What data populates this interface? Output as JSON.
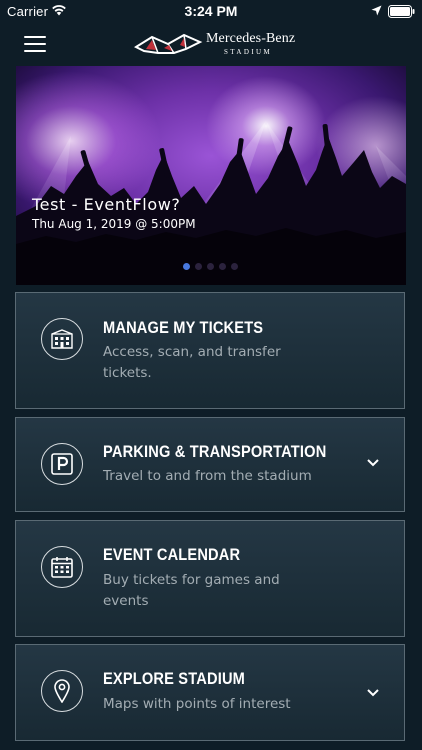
{
  "status_bar": {
    "carrier": "Carrier",
    "time": "3:24 PM"
  },
  "header": {
    "logo_name": "Mercedes-Benz",
    "logo_sub": "STADIUM"
  },
  "hero": {
    "title": "Test - EventFlow?",
    "subtitle": "Thu Aug 1, 2019 @ 5:00PM",
    "page_count": 5,
    "active_page": 1
  },
  "cards": [
    {
      "id": "manage-tickets",
      "icon": "stadium-icon",
      "title": "MANAGE MY TICKETS",
      "description": "Access, scan, and transfer tickets.",
      "expandable": false
    },
    {
      "id": "parking",
      "icon": "parking-icon",
      "title": "PARKING & TRANSPORTATION",
      "description": "Travel to and from the stadium",
      "expandable": true
    },
    {
      "id": "event-calendar",
      "icon": "calendar-icon",
      "title": "EVENT CALENDAR",
      "description": "Buy tickets for games and events",
      "expandable": false
    },
    {
      "id": "explore",
      "icon": "map-pin-icon",
      "title": "EXPLORE STADIUM",
      "description": "Maps with points of interest",
      "expandable": true
    }
  ],
  "colors": {
    "background": "#0e1d27",
    "card_border": "#5a6a74",
    "active_dot": "#4878de",
    "description_text": "#a3adb3"
  }
}
